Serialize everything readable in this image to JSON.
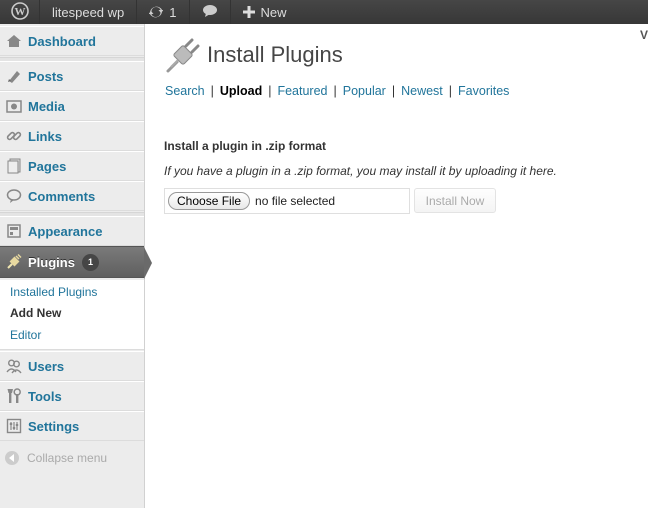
{
  "adminbar": {
    "site_name": "litespeed wp",
    "updates_count": "1",
    "new_label": "New",
    "icons": [
      "wordpress-icon",
      "updates-icon",
      "comments-icon",
      "plus-icon"
    ]
  },
  "sidebar": {
    "items": [
      {
        "label": "Dashboard",
        "icon": "dashboard-icon"
      },
      {
        "label": "Posts",
        "icon": "posts-icon"
      },
      {
        "label": "Media",
        "icon": "media-icon"
      },
      {
        "label": "Links",
        "icon": "links-icon"
      },
      {
        "label": "Pages",
        "icon": "pages-icon"
      },
      {
        "label": "Comments",
        "icon": "comments-icon"
      },
      {
        "label": "Appearance",
        "icon": "appearance-icon"
      },
      {
        "label": "Plugins",
        "icon": "plugins-icon",
        "badge": "1",
        "active": true
      },
      {
        "label": "Users",
        "icon": "users-icon"
      },
      {
        "label": "Tools",
        "icon": "tools-icon"
      },
      {
        "label": "Settings",
        "icon": "settings-icon"
      }
    ],
    "submenu": [
      {
        "label": "Installed Plugins"
      },
      {
        "label": "Add New",
        "current": true
      },
      {
        "label": "Editor"
      }
    ],
    "collapse_label": "Collapse menu"
  },
  "main": {
    "title": "Install Plugins",
    "tabs": [
      {
        "label": "Search"
      },
      {
        "label": "Upload",
        "current": true
      },
      {
        "label": "Featured"
      },
      {
        "label": "Popular"
      },
      {
        "label": "Newest"
      },
      {
        "label": "Favorites"
      }
    ],
    "tab_separator": "|",
    "section_title": "Install a plugin in .zip format",
    "section_desc": "If you have a plugin in a .zip format, you may install it by uploading it here.",
    "choose_file_label": "Choose File",
    "file_status": "no file selected",
    "install_button": "Install Now",
    "edge_mark": "V"
  },
  "colors": {
    "link": "#21759b",
    "adminbar_bg": "#464646",
    "sidebar_bg": "#ececec",
    "active_menu_bg": "#6a6a6a"
  }
}
